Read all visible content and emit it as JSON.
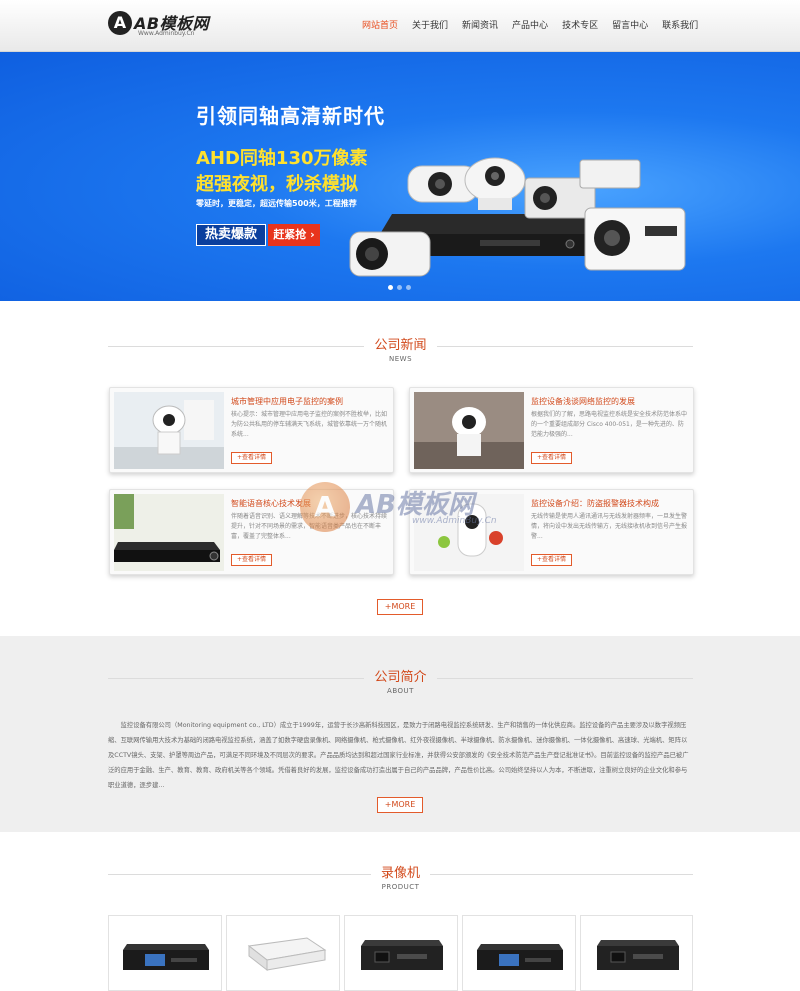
{
  "header": {
    "logo_mark": "A",
    "logo_name": "AB模板网",
    "logo_sub": "Www.Adminbuy.Cn",
    "nav": [
      {
        "label": "网站首页",
        "active": true
      },
      {
        "label": "关于我们",
        "active": false
      },
      {
        "label": "新闻资讯",
        "active": false
      },
      {
        "label": "产品中心",
        "active": false
      },
      {
        "label": "技术专区",
        "active": false
      },
      {
        "label": "留言中心",
        "active": false
      },
      {
        "label": "联系我们",
        "active": false
      }
    ]
  },
  "banner": {
    "headline": "引领同轴高清新时代",
    "line1": "AHD同轴130万像素",
    "line2": "超强夜视，秒杀模拟",
    "tagline": "零延时，更稳定，超远传输500米，工程推荐",
    "hot_label": "热卖爆款",
    "grab_label": "赶紧抢",
    "slides": 3,
    "active_slide": 0
  },
  "news": {
    "title": "公司新闻",
    "subtitle": "NEWS",
    "more_item_label": "+查看详情",
    "items": [
      {
        "title": "城市管理中应用电子监控的案例",
        "desc": "核心提示：城市管理中应用电子监控的案例不胜枚举，比如为防公共私用的停车辅满天飞系统，城管依靠统一万个随机系统..."
      },
      {
        "title": "监控设备浅谈网络监控的发展",
        "desc": "根据我们的了解，思路电视监控系统是安全技术防范体系中的一个重要组成部分 Cisco 400-051，是一种先进的、防范能力极强的..."
      },
      {
        "title": "智能语音核心技术发展",
        "desc": "伴随着语音识别、语义理解等技术不断进步，核心技术持续提升，针对不同场景的需求，智能语音类产品也在不断丰富，覆盖了完整体系..."
      },
      {
        "title": "监控设备介绍：防盗报警器技术构成",
        "desc": "无线传输是使用人通讯通讯与无线发射器频率，一旦发生警情，将向设中发出无线传输方，无线接收机收到信号产生报警..."
      }
    ],
    "more_label": "+MORE"
  },
  "about": {
    "title": "公司简介",
    "subtitle": "ABOUT",
    "text": "监控设备有限公司（Monitoring equipment co., LTD）成立于1999年，运营于长沙高新科技园区，是致力于闭路电视监控系统研发、生产和销售的一体化供应商。监控设备的产品主要涉及以数字视频压缩、互联网传输用大技术为基础的闭路电视监控系统，涵盖了如数字硬盘录像机、网络摄像机、枪式摄像机、红外夜视摄像机、半球摄像机、防水摄像机、迷你摄像机、一体化摄像机、高速球、光端机、矩阵以及CCTV镜头、支架、护罩等周边产品，可满足不同环境及不同层次的要求。产品品质均达到和超过国家行业标准，并获得公安部颁发的《安全技术防范产品生产登记批准证书》。目前监控设备的监控产品已被广泛的应用于金融、生产、教育、教育、政府机关等各个领域。凭借着良好的发展，监控设备成功打造出属于自己的产品品牌，产品性价比高。公司始终坚持以人为本，不断进取，注重树立良好的企业文化和参与职业道德，逐步建...",
    "more_label": "+MORE"
  },
  "products": {
    "title": "录像机",
    "subtitle": "PRODUCT",
    "items": [
      {
        "kind": "nvr-screen"
      },
      {
        "kind": "white-box"
      },
      {
        "kind": "dark-dvr"
      },
      {
        "kind": "nvr-screen"
      },
      {
        "kind": "dark-dvr"
      }
    ]
  },
  "watermark": {
    "mark": "A",
    "name": "AB模板网",
    "url": "www.AdminBuy.Cn"
  }
}
